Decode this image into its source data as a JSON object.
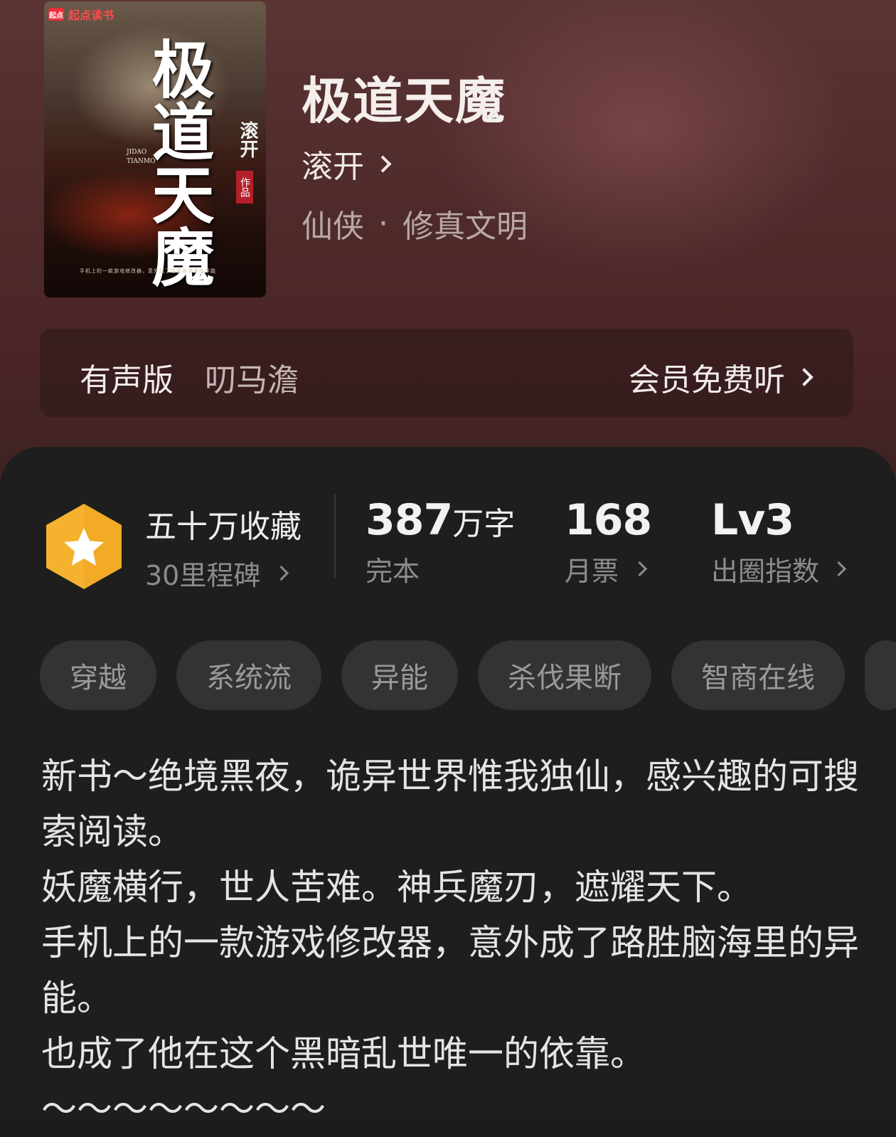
{
  "book": {
    "cover": {
      "brand": "起点读书",
      "brand_logo": "起点",
      "title": "极道天魔",
      "pinyin_line1": "JIDAO",
      "pinyin_line2": "TIANMO",
      "author": "滚开",
      "author_tag": "作品",
      "tagline": "手机上的一款游戏修改器，意外成了路胜脑海里的异能"
    },
    "title": "极道天魔",
    "author": "滚开",
    "genre": "仙侠",
    "genre_sep": "·",
    "subgenre": "修真文明"
  },
  "audio": {
    "label": "有声版",
    "narrator": "叨马澹",
    "action": "会员免费听"
  },
  "stats": {
    "badge_icon": "star-hexagon-icon",
    "collection": "五十万收藏",
    "milestone": "30里程碑",
    "words_num": "387",
    "words_unit": "万字",
    "status": "完本",
    "monthly_votes": "168",
    "monthly_votes_label": "月票",
    "level": "Lv3",
    "level_label": "出圈指数"
  },
  "tags": [
    "穿越",
    "系统流",
    "异能",
    "杀伐果断",
    "智商在线"
  ],
  "description": [
    "新书～绝境黑夜，诡异世界惟我独仙，感兴趣的可搜索阅读。",
    "妖魔横行，世人苦难。神兵魔刃，遮耀天下。",
    "手机上的一款游戏修改器，意外成了路胜脑海里的异能。",
    "也成了他在这个黑暗乱世唯一的依靠。",
    "～～～～～～～～"
  ],
  "colors": {
    "header_bg": "#4e2a2b",
    "body_bg": "#1e1e1e",
    "badge_gold": "#f5b22e",
    "tag_bg": "#333333"
  }
}
